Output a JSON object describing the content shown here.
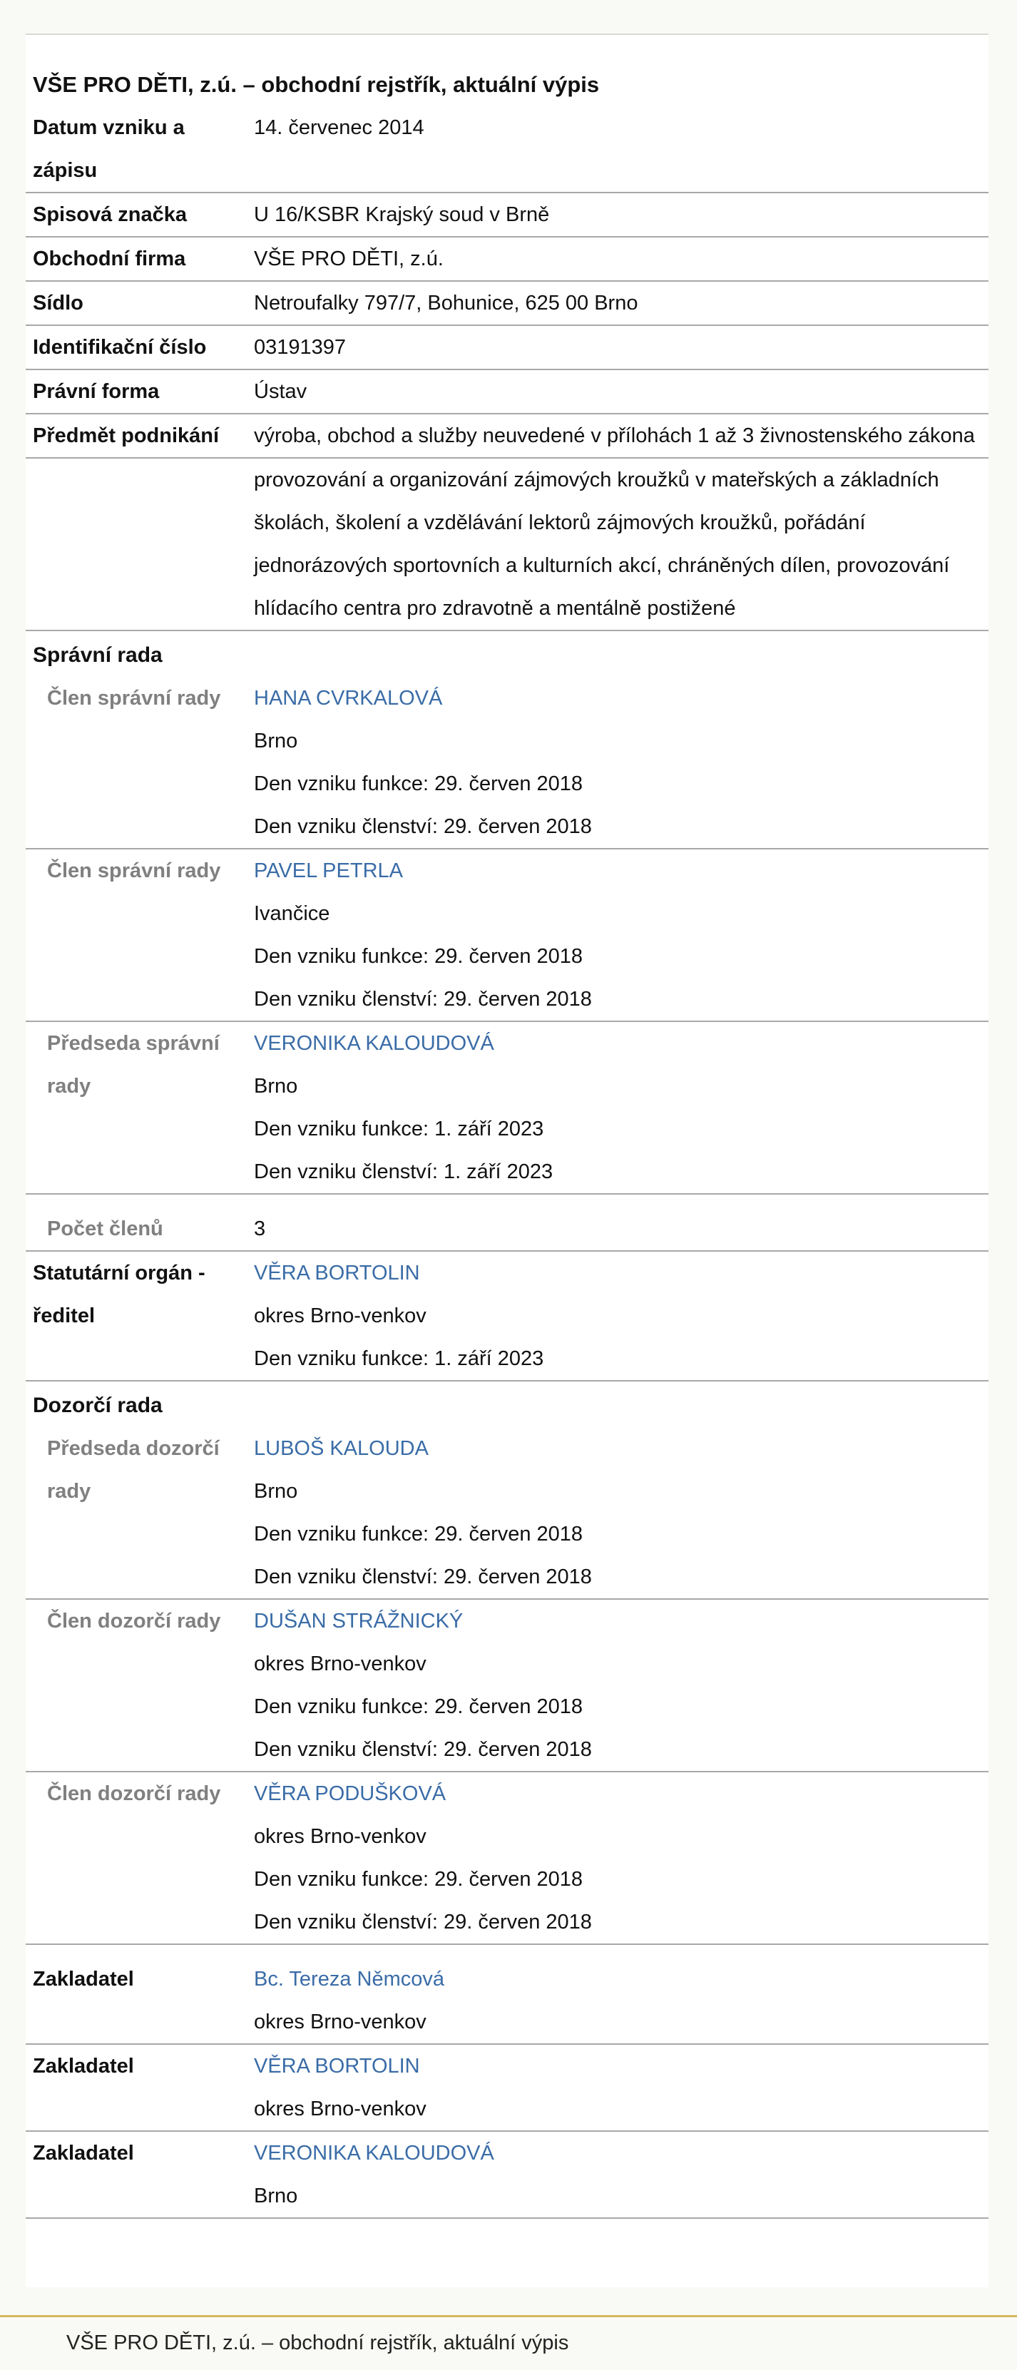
{
  "title": "VŠE PRO DĚTI, z.ú. – obchodní rejstřík, aktuální výpis",
  "basic": [
    {
      "label": "Datum vzniku a zápisu",
      "value": "14. červenec 2014"
    },
    {
      "label": "Spisová značka",
      "value": "U 16/KSBR Krajský soud v Brně"
    },
    {
      "label": "Obchodní firma",
      "value": "VŠE PRO DĚTI, z.ú."
    },
    {
      "label": "Sídlo",
      "value": "Netroufalky 797/7, Bohunice, 625 00 Brno"
    },
    {
      "label": "Identifikační číslo",
      "value": "03191397"
    },
    {
      "label": "Právní forma",
      "value": "Ústav"
    }
  ],
  "predmet": {
    "label": "Předmět podnikání",
    "values": [
      "výroba, obchod a služby neuvedené v přílohách 1 až 3 živnostenského zákona",
      "provozování a organizování zájmových kroužků v mateřských a základních školách, školení a vzdělávání lektorů zájmových kroužků, pořádání jednorázových sportovních a kulturních akcí, chráněných dílen, provozování hlídacího centra pro zdravotně a mentálně postižené"
    ]
  },
  "spravni_rada": {
    "heading": "Správní rada",
    "members": [
      {
        "role": "Člen správní rady",
        "name": "HANA CVRKALOVÁ",
        "place": "Brno",
        "funkce": "Den vzniku funkce: 29. červen 2018",
        "clenstvi": "Den vzniku členství: 29. červen 2018"
      },
      {
        "role": "Člen správní rady",
        "name": "PAVEL PETRLA",
        "place": "Ivančice",
        "funkce": "Den vzniku funkce: 29. červen 2018",
        "clenstvi": "Den vzniku členství: 29. červen 2018"
      },
      {
        "role": "Předseda správní rady",
        "name": "VERONIKA KALOUDOVÁ",
        "place": "Brno",
        "funkce": "Den vzniku funkce: 1. září 2023",
        "clenstvi": "Den vzniku členství: 1. září 2023"
      }
    ],
    "pocet_label": "Počet členů",
    "pocet_value": "3"
  },
  "statutar": {
    "label": "Statutární orgán - ředitel",
    "name": "VĚRA BORTOLIN",
    "place": "okres Brno-venkov",
    "funkce": "Den vzniku funkce: 1. září 2023"
  },
  "dozorci_rada": {
    "heading": "Dozorčí rada",
    "members": [
      {
        "role": "Předseda dozorčí rady",
        "name": "LUBOŠ KALOUDA",
        "place": "Brno",
        "funkce": "Den vzniku funkce: 29. červen 2018",
        "clenstvi": "Den vzniku členství: 29. červen 2018"
      },
      {
        "role": "Člen dozorčí rady",
        "name": "DUŠAN STRÁŽNICKÝ",
        "place": "okres Brno-venkov",
        "funkce": "Den vzniku funkce: 29. červen 2018",
        "clenstvi": "Den vzniku členství: 29. červen 2018"
      },
      {
        "role": "Člen dozorčí rady",
        "name": "VĚRA PODUŠKOVÁ",
        "place": "okres Brno-venkov",
        "funkce": "Den vzniku funkce: 29. červen 2018",
        "clenstvi": "Den vzniku členství: 29. červen 2018"
      }
    ]
  },
  "zakladatele": [
    {
      "label": "Zakladatel",
      "name": "Bc. Tereza Němcová",
      "place": "okres Brno-venkov"
    },
    {
      "label": "Zakladatel",
      "name": "VĚRA BORTOLIN",
      "place": "okres Brno-venkov"
    },
    {
      "label": "Zakladatel",
      "name": "VERONIKA KALOUDOVÁ",
      "place": "Brno"
    }
  ],
  "footer": "VŠE PRO DĚTI, z.ú. – obchodní rejstřík, aktuální výpis",
  "colors": {
    "link": "#3a6ca7",
    "sublabel": "#808080",
    "footer_line": "#d8b65a"
  }
}
